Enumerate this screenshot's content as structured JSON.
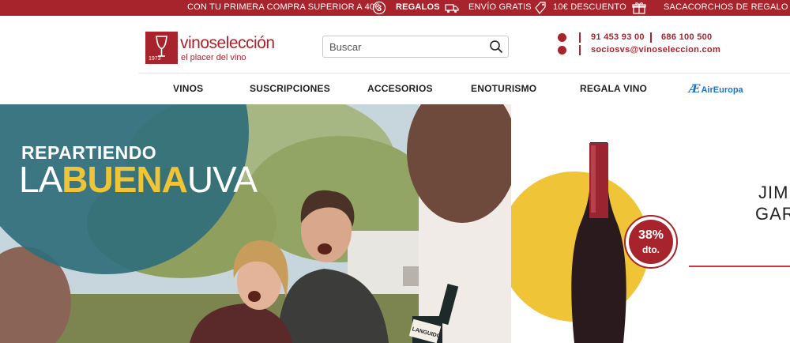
{
  "promo": {
    "first_purchase": "CON TU PRIMERA COMPRA SUPERIOR A 40€",
    "gifts": "REGALOS",
    "free_shipping": "ENVÍO GRATIS",
    "discount": "10€ DESCUENTO",
    "corkscrew": "SACACORCHOS DE REGALO",
    "icons": [
      "number-3-icon",
      "truck-icon",
      "tag-icon",
      "gift-icon"
    ]
  },
  "header": {
    "logo_name": "vinoselección",
    "logo_tagline": "el placer del vino",
    "logo_year": "1973",
    "search_placeholder": "Buscar",
    "phone_1": "91 453 93 00",
    "phone_2": "686 100 500",
    "email": "sociosvs@vinoseleccion.com"
  },
  "nav": {
    "items": [
      "VINOS",
      "SUSCRIPCIONES",
      "ACCESORIOS",
      "ENOTURISMO",
      "REGALA VINO"
    ],
    "partner_mark": "Æ",
    "partner": "AirEuropa"
  },
  "hero": {
    "slogan_line1": "REPARTIENDO",
    "slogan_la": "LA",
    "slogan_buena": "BUENA",
    "slogan_uva": "UVA",
    "bottle_label": "LANGUIDO",
    "discount_pct": "38%",
    "discount_label": "dto.",
    "product_line1": "JIM",
    "product_line2": "GAR"
  },
  "colors": {
    "brand": "#a8242c",
    "accent_yellow": "#f0c437",
    "teal": "#2f6e79",
    "partner_blue": "#1a73c8"
  }
}
